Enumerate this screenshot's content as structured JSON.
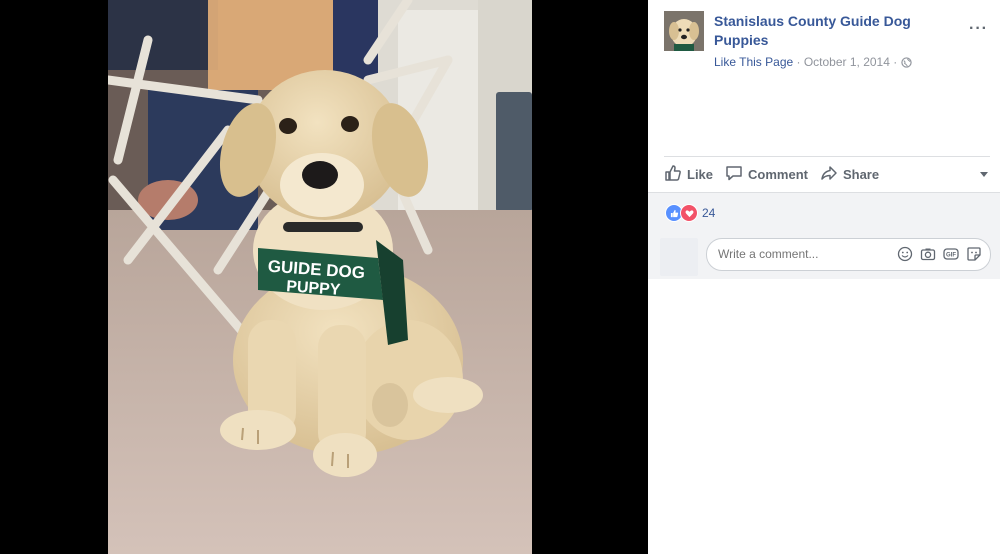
{
  "post": {
    "page_name": "Stanislaus County Guide Dog Puppies",
    "like_page": "Like This Page",
    "separator": " · ",
    "date": "October 1, 2014",
    "separator2": " · ",
    "more_label": "···"
  },
  "photo": {
    "vest_text_line1": "GUIDE DOG",
    "vest_text_line2": "PUPPY"
  },
  "actions": {
    "like": "Like",
    "comment": "Comment",
    "share": "Share"
  },
  "reactions": {
    "count": "24"
  },
  "comment": {
    "placeholder": "Write a comment..."
  },
  "icons": {
    "like": "thumbs-up-icon",
    "comment": "speech-bubble-icon",
    "share": "share-arrow-icon",
    "globe": "globe-icon",
    "emoji": "smiley-icon",
    "camera": "camera-icon",
    "gif": "gif-icon",
    "sticker": "sticker-icon"
  },
  "colors": {
    "link": "#385898",
    "muted": "#90949c",
    "action": "#606770",
    "like_reaction": "#5890ff",
    "love_reaction": "#f25268",
    "vest": "#1f5a42"
  }
}
